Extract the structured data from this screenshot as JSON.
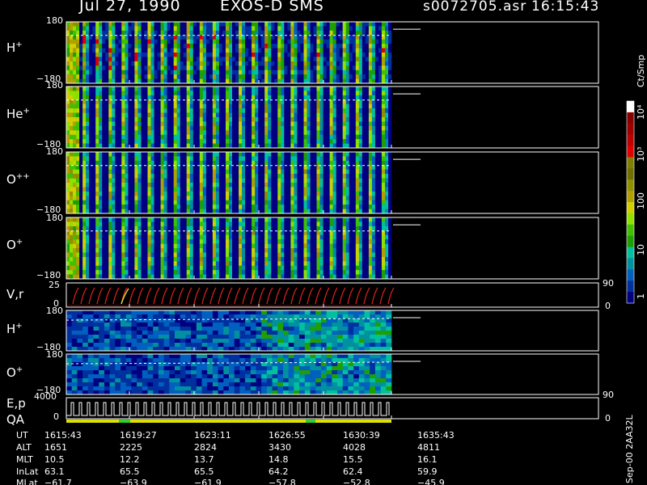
{
  "header": {
    "date": "Jul 27, 1990",
    "instrument": "EXOS-D SMS",
    "filename": "s0072705.asr",
    "time": "16:15:43"
  },
  "panels": [
    {
      "id": "hplus",
      "label": "H",
      "sup": "+",
      "top": "180",
      "bottom": "−180"
    },
    {
      "id": "heplus",
      "label": "He",
      "sup": "+",
      "top": "180",
      "bottom": "−180"
    },
    {
      "id": "oplusplus",
      "label": "O",
      "sup": "++",
      "top": "180",
      "bottom": "−180"
    },
    {
      "id": "oplus",
      "label": "O",
      "sup": "+",
      "top": "180",
      "bottom": "−180"
    },
    {
      "id": "vr",
      "label": "V,r",
      "sup": "",
      "top": "25",
      "bottom": "0",
      "right_top": "90",
      "right_bottom": "0"
    },
    {
      "id": "hplus2",
      "label": "H",
      "sup": "+",
      "top": "180",
      "bottom": "−180"
    },
    {
      "id": "oplus2",
      "label": "O",
      "sup": "+",
      "top": "180",
      "bottom": "−180",
      "right_bottom": "90"
    },
    {
      "id": "ep",
      "label": "E,p",
      "label2": "QA",
      "sup": "",
      "top": "4000",
      "bottom": "0",
      "right_bottom": "0"
    }
  ],
  "colorbar": {
    "title": "Ct/Smp",
    "labels": [
      "10⁴",
      "10³",
      "100",
      "10",
      "1"
    ],
    "colors": [
      "#ffffff",
      "#8b0000",
      "#a00000",
      "#c00000",
      "#e00000",
      "#808000",
      "#707000",
      "#909000",
      "#b0a000",
      "#d0d000",
      "#90e000",
      "#40c000",
      "#20a000",
      "#00c0a0",
      "#0090a0",
      "#0060c0",
      "#0030a0",
      "#000080"
    ]
  },
  "side_text": "Sep-00  2AA32L",
  "stats": {
    "labels": [
      "UT",
      "ALT",
      "MLT",
      "InLat",
      "MLat"
    ],
    "columns": [
      {
        "UT": "1615:43",
        "ALT": "1651",
        "MLT": "10.5",
        "InLat": "63.1",
        "MLat": "−61.7"
      },
      {
        "UT": "1619:27",
        "ALT": "2225",
        "MLT": "12.2",
        "InLat": "65.5",
        "MLat": "−63.9"
      },
      {
        "UT": "1623:11",
        "ALT": "2824",
        "MLT": "13.7",
        "InLat": "65.5",
        "MLat": "−61.9"
      },
      {
        "UT": "1626:55",
        "ALT": "3430",
        "MLT": "14.8",
        "InLat": "64.2",
        "MLat": "−57.8"
      },
      {
        "UT": "1630:39",
        "ALT": "4028",
        "MLT": "15.5",
        "InLat": "62.4",
        "MLat": "−52.8"
      },
      {
        "UT": "1635:43",
        "ALT": "4811",
        "MLT": "16.1",
        "InLat": "59.9",
        "MLat": "−45.9"
      }
    ]
  },
  "chart_data": {
    "type": "heatmap",
    "title": "Jul 27, 1990   EXOS-D SMS",
    "x_tick_labels": [
      "1615:43",
      "1619:27",
      "1623:11",
      "1626:55",
      "1630:39",
      "1635:43"
    ],
    "y_range": [
      -180,
      180
    ],
    "color_scale": "log",
    "color_range": [
      1,
      10000
    ],
    "colorbar_label": "Ct/Smp",
    "series": [
      {
        "name": "H+"
      },
      {
        "name": "He+"
      },
      {
        "name": "O++"
      },
      {
        "name": "O+"
      },
      {
        "name": "V,r"
      },
      {
        "name": "H+"
      },
      {
        "name": "O+"
      },
      {
        "name": "E,p"
      }
    ]
  }
}
